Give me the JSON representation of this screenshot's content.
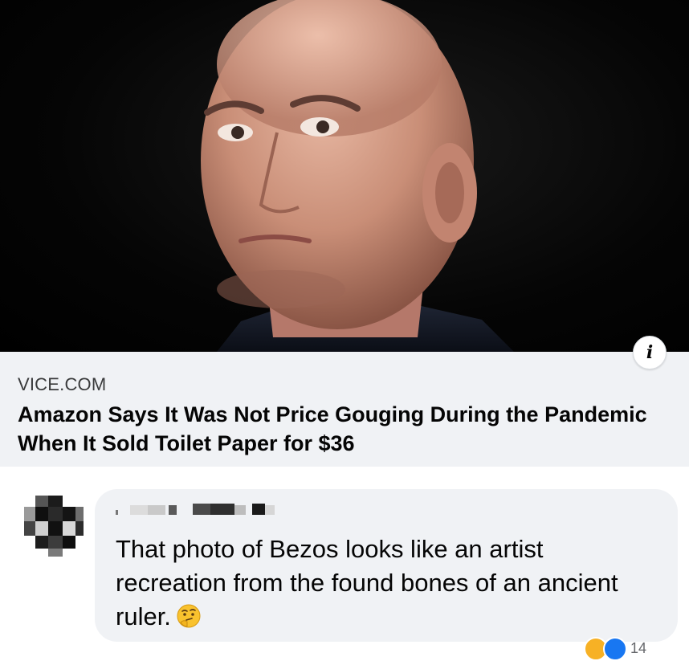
{
  "link_preview": {
    "domain": "VICE.COM",
    "title": "Amazon Says It Was Not Price Gouging During the Pandemic When It Sold Toilet Paper for $36",
    "info_button_glyph": "i"
  },
  "comment": {
    "text": "That photo of Bezos looks like an artist recreation from the found bones of an ancient ruler.",
    "emoji": "thinking-face-icon",
    "reaction_count": "14"
  },
  "colors": {
    "card_background": "#f0f2f5",
    "bubble_background": "#f0f2f5",
    "text_primary": "#050505",
    "text_secondary": "#65676b",
    "like_blue": "#1877f2",
    "haha_yellow": "#f7b125"
  }
}
